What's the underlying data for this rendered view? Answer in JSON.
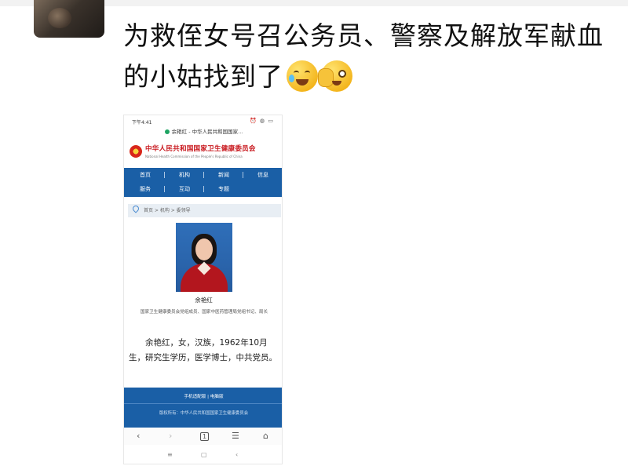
{
  "post": {
    "text": "为救侄女号召公务员、警察及解放军献血的小姑找到了"
  },
  "icons": [
    "crying-laughing-emoji-icon",
    "peeking-face-emoji-icon",
    "back-icon",
    "forward-icon",
    "tabs-icon",
    "menu-icon",
    "home-icon"
  ],
  "phone": {
    "status_time": "下午4:41",
    "status_icons": "⏰ ◍ ▭",
    "url_title": "余艳红 - 中华人民共和国国家...",
    "site_title": "中华人民共和国国家卫生健康委员会",
    "site_subtitle": "National Health Commission of the People's Republic of China",
    "nav": [
      "首页",
      "机构",
      "新闻",
      "信息",
      "服务",
      "互动",
      "专题"
    ],
    "breadcrumb": "首页 > 机构 > 委领导",
    "person_name": "余艳红",
    "person_role": "国家卫生健康委员会党组成员、国家中医药管理局党组书记、局长",
    "bio": "余艳红，女，汉族，1962年10月生，研究生学历，医学博士，中共党员。",
    "footer_links": "手机适配版 | 电脑版",
    "footer_copyright": "版权所有：中华人民共和国国家卫生健康委员会",
    "browser_buttons": [
      "‹",
      "›",
      "1",
      "☰",
      "⌂"
    ],
    "system_buttons": [
      "≡",
      "▢",
      "‹"
    ]
  },
  "colors": {
    "nav_blue": "#1a5fa6",
    "site_red": "#c8171d"
  }
}
